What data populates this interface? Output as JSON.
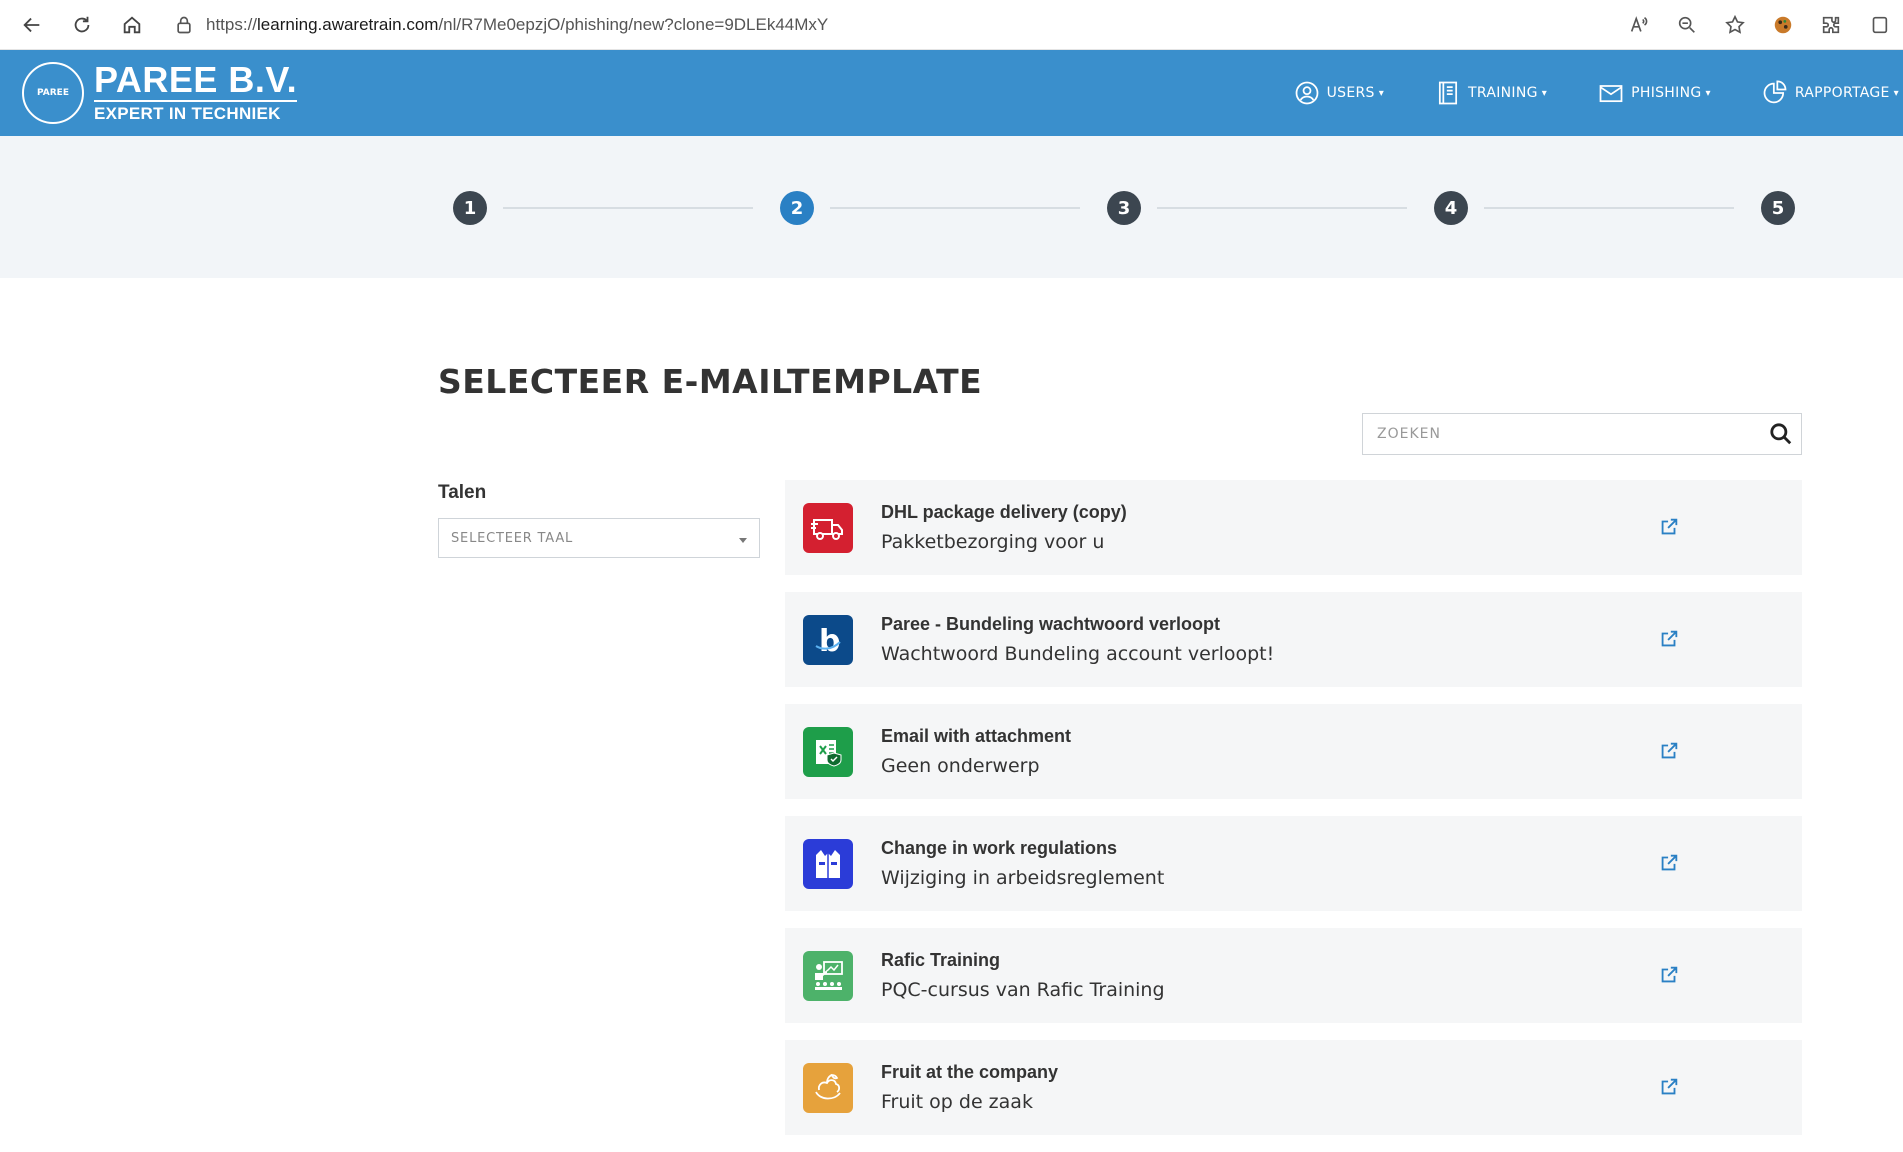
{
  "browser": {
    "url_prefix": "https://",
    "url_domain": "learning.awaretrain.com",
    "url_path": "/nl/R7Me0epzjO/phishing/new?clone=9DLEk44MxY"
  },
  "brand": {
    "name": "PAREE B.V.",
    "tagline": "EXPERT IN TECHNIEK",
    "seal_text": "PAREE",
    "color_header": "#3a8fcc"
  },
  "menu": {
    "users": "USERS",
    "training": "TRAINING",
    "phishing": "PHISHING",
    "rapportage": "RAPPORTAGE"
  },
  "stepper": {
    "steps": [
      "1",
      "2",
      "3",
      "4",
      "5"
    ],
    "active": 2,
    "active_color": "#2a80c4"
  },
  "page": {
    "title": "SELECTEER E-MAILTEMPLATE",
    "search_placeholder": "ZOEKEN",
    "filter_label": "Talen",
    "language_select": "SELECTEER TAAL"
  },
  "templates": [
    {
      "title": "DHL package delivery (copy)",
      "subject": "Pakketbezorging voor u",
      "icon": "truck-icon",
      "color": "#d42030"
    },
    {
      "title": "Paree - Bundeling wachtwoord verloopt",
      "subject": "Wachtwoord Bundeling account verloopt!",
      "icon": "bundeling-b-icon",
      "color": "#0c4a8a"
    },
    {
      "title": "Email with attachment",
      "subject": "Geen onderwerp",
      "icon": "excel-shield-icon",
      "color": "#1e9e4a"
    },
    {
      "title": "Change in work regulations",
      "subject": "Wijziging in arbeidsreglement",
      "icon": "vest-icon",
      "color": "#2b3cd8"
    },
    {
      "title": "Rafic Training",
      "subject": "PQC-cursus van Rafic Training",
      "icon": "classroom-icon",
      "color": "#4db26a"
    },
    {
      "title": "Fruit at the company",
      "subject": "Fruit op de zaak",
      "icon": "fruit-icon",
      "color": "#e6a23c"
    }
  ]
}
